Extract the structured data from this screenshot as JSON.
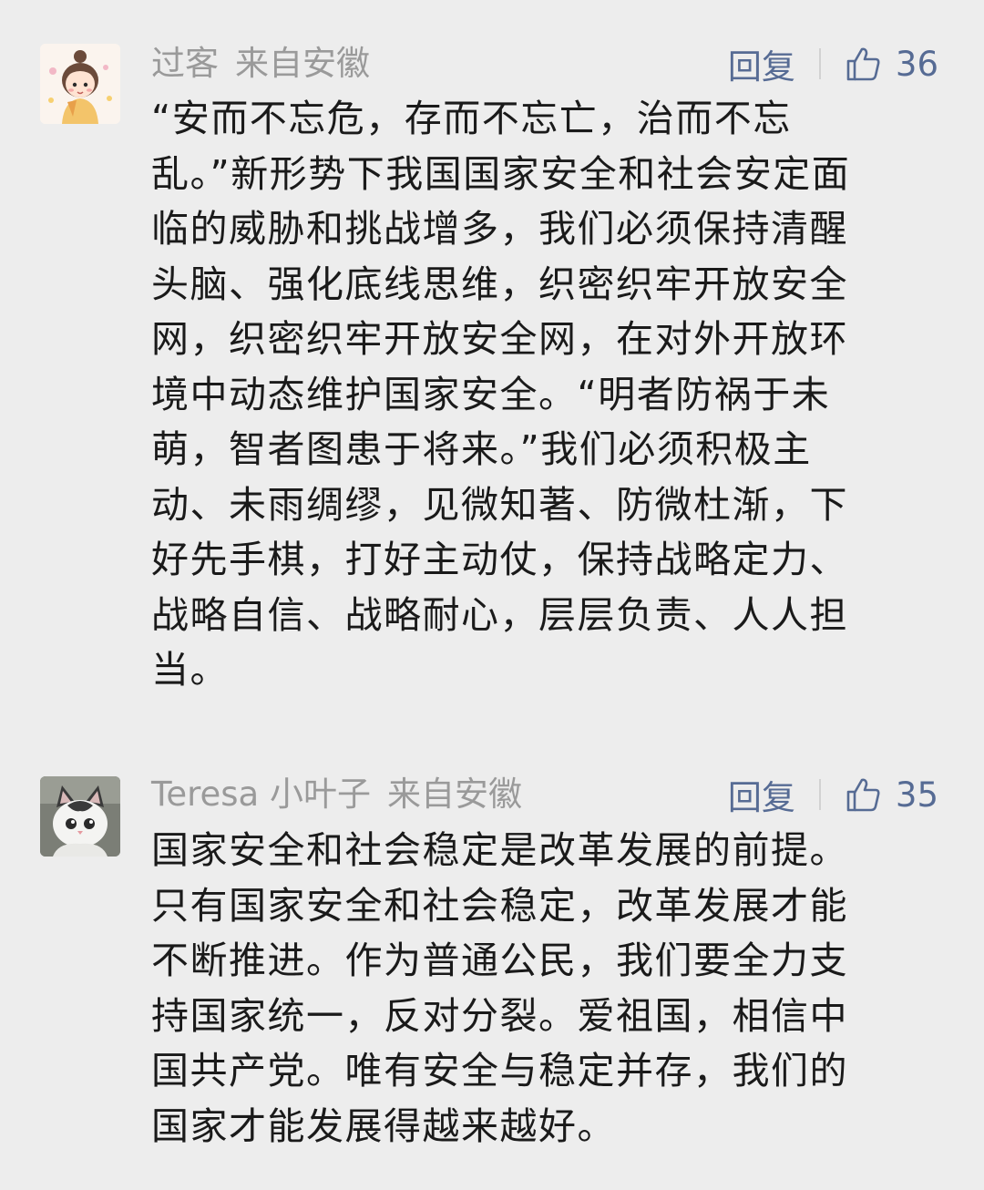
{
  "comments": [
    {
      "user": "过客",
      "location": "来自安徽",
      "reply_label": "回复",
      "likes": "36",
      "avatar_icon": "cartoon-girl-avatar",
      "text": "“安而不忘危，存而不忘亡，治而不忘\n乱。”新形势下我国国家安全和社会安定面\n临的威胁和挑战增多，我们必须保持清醒\n头脑、强化底线思维，织密织牢开放安全\n网，织密织牢开放安全网，在对外开放环\n境中动态维护国家安全。“明者防祸于未\n萌，智者图患于将来。”我们必须积极主\n动、未雨绸缪，见微知著、防微杜渐，下\n好先手棋，打好主动仗，保持战略定力、\n战略自信、战略耐心，层层负责、人人担\n当。"
    },
    {
      "user": "Teresa 小叶子",
      "location": "来自安徽",
      "reply_label": "回复",
      "likes": "35",
      "avatar_icon": "cartoon-cat-avatar",
      "text": "国家安全和社会稳定是改革发展的前提。\n只有国家安全和社会稳定，改革发展才能\n不断推进。作为普通公民，我们要全力支\n持国家统一，反对分裂。爱祖国，相信中\n国共产党。唯有安全与稳定并存，我们的\n国家才能发展得越来越好。"
    }
  ],
  "colors": {
    "background": "#ededed",
    "text": "#1a1a1a",
    "meta": "#9a9a9a",
    "link": "#566b94"
  },
  "icons": {
    "like": "thumbs-up-icon"
  }
}
